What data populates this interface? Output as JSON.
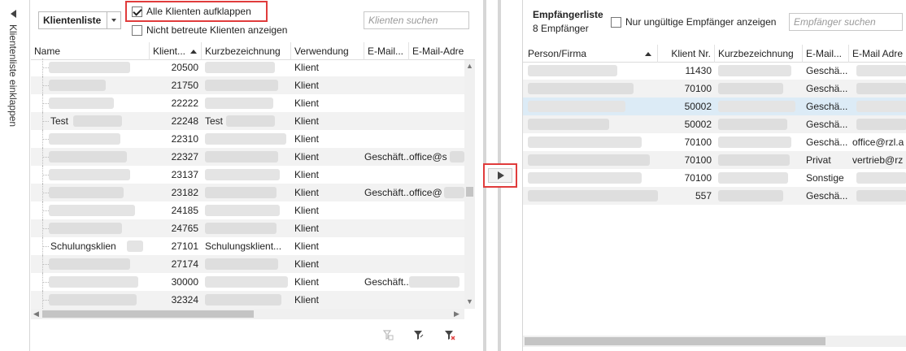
{
  "rail": {
    "label": "Klientenliste einklappen"
  },
  "left": {
    "list_select": "Klientenliste",
    "expand_all": "Alle Klienten aufklappen",
    "show_unattended": "Nicht betreute Klienten anzeigen",
    "search_placeholder": "Klienten suchen",
    "columns": [
      "Name",
      "Klient...",
      "Kurzbezeichnung",
      "Verwendung",
      "E-Mail...",
      "E-Mail-Adre"
    ],
    "rows": [
      {
        "name": "",
        "nr": "20500",
        "kurz": "",
        "verw": "Klient",
        "mailtype": "",
        "mail": ""
      },
      {
        "name": "",
        "nr": "21750",
        "kurz": "",
        "verw": "Klient",
        "mailtype": "",
        "mail": ""
      },
      {
        "name": "",
        "nr": "22222",
        "kurz": "",
        "verw": "Klient",
        "mailtype": "",
        "mail": ""
      },
      {
        "name": "Test",
        "nr": "22248",
        "kurz": "Test",
        "verw": "Klient",
        "mailtype": "",
        "mail": ""
      },
      {
        "name": "",
        "nr": "22310",
        "kurz": "",
        "verw": "Klient",
        "mailtype": "",
        "mail": ""
      },
      {
        "name": "",
        "nr": "22327",
        "kurz": "",
        "verw": "Klient",
        "mailtype": "Geschäft...",
        "mail": "office@s"
      },
      {
        "name": "",
        "nr": "23137",
        "kurz": "",
        "verw": "Klient",
        "mailtype": "",
        "mail": ""
      },
      {
        "name": "",
        "nr": "23182",
        "kurz": "",
        "verw": "Klient",
        "mailtype": "Geschäft...",
        "mail": "office@"
      },
      {
        "name": "",
        "nr": "24185",
        "kurz": "",
        "verw": "Klient",
        "mailtype": "",
        "mail": ""
      },
      {
        "name": "",
        "nr": "24765",
        "kurz": "",
        "verw": "Klient",
        "mailtype": "",
        "mail": ""
      },
      {
        "name": "Schulungsklient",
        "nr": "27101",
        "kurz": "Schulungsklient...",
        "verw": "Klient",
        "mailtype": "",
        "mail": ""
      },
      {
        "name": "",
        "nr": "27174",
        "kurz": "",
        "verw": "Klient",
        "mailtype": "",
        "mail": ""
      },
      {
        "name": "",
        "nr": "30000",
        "kurz": "",
        "verw": "Klient",
        "mailtype": "Geschäft...",
        "mail": ""
      },
      {
        "name": "",
        "nr": "32324",
        "kurz": "",
        "verw": "Klient",
        "mailtype": "",
        "mail": ""
      }
    ]
  },
  "right": {
    "title": "Empfängerliste",
    "count": "8 Empfänger",
    "only_invalid": "Nur ungültige Empfänger anzeigen",
    "search_placeholder": "Empfänger suchen",
    "columns": [
      "Person/Firma",
      "Klient Nr.",
      "Kurzbezeichnung",
      "E-Mail...",
      "E-Mail Adre"
    ],
    "rows": [
      {
        "nr": "11430",
        "mailtype": "Geschä...",
        "mail": ""
      },
      {
        "nr": "70100",
        "mailtype": "Geschä...",
        "mail": ""
      },
      {
        "nr": "50002",
        "mailtype": "Geschä...",
        "mail": ""
      },
      {
        "nr": "50002",
        "mailtype": "Geschä...",
        "mail": ""
      },
      {
        "nr": "70100",
        "mailtype": "Geschä...",
        "mail": "office@rzl.a"
      },
      {
        "nr": "70100",
        "mailtype": "Privat",
        "mail": "vertrieb@rz"
      },
      {
        "nr": "70100",
        "mailtype": "Sonstige",
        "mail": ""
      },
      {
        "nr": "557",
        "mailtype": "Geschä...",
        "mail": ""
      }
    ]
  }
}
